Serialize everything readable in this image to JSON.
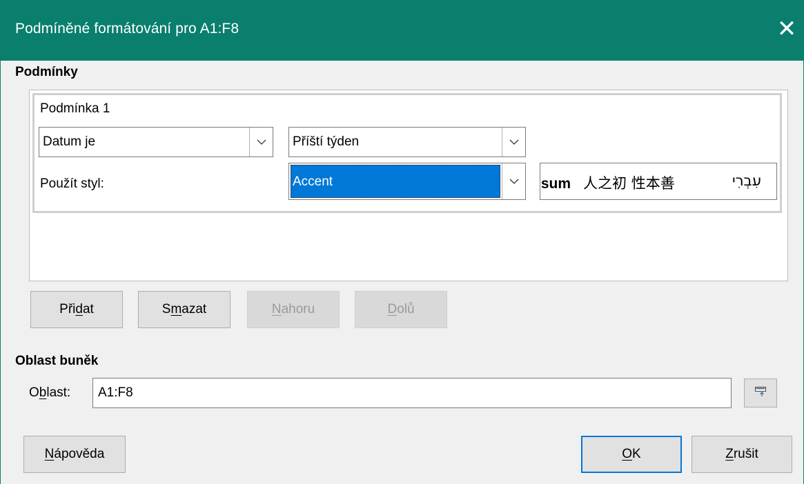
{
  "window": {
    "title": "Podmíněné formátování pro A1:F8"
  },
  "conditions_section": {
    "label": "Podmínky",
    "condition": {
      "title": "Podmínka 1",
      "type_select": "Datum je",
      "date_select": "Příští týden",
      "apply_style_label": "Použít styl:",
      "style_select": "Accent",
      "preview": {
        "latin": "psum",
        "cjk": "人之初 性本善",
        "hebrew": "עִבְרִי"
      }
    },
    "buttons": {
      "add": {
        "before": "Při",
        "mnemonic": "d",
        "after": "at"
      },
      "delete": {
        "before": "S",
        "mnemonic": "m",
        "after": "azat"
      },
      "up": {
        "before": "",
        "mnemonic": "N",
        "after": "ahoru"
      },
      "down": {
        "before": "",
        "mnemonic": "D",
        "after": "olů"
      }
    }
  },
  "range_section": {
    "label": "Oblast buněk",
    "field_label": {
      "before": "O",
      "mnemonic": "b",
      "after": "last:"
    },
    "field_value": "A1:F8"
  },
  "footer": {
    "help": {
      "before": "",
      "mnemonic": "N",
      "after": "ápověda"
    },
    "ok": {
      "before": "",
      "mnemonic": "O",
      "after": "K"
    },
    "cancel": {
      "before": "",
      "mnemonic": "Z",
      "after": "rušit"
    }
  },
  "colors": {
    "titlebar": "#0a7f6d",
    "selection": "#0078d7",
    "default_button_border": "#0078d7"
  }
}
